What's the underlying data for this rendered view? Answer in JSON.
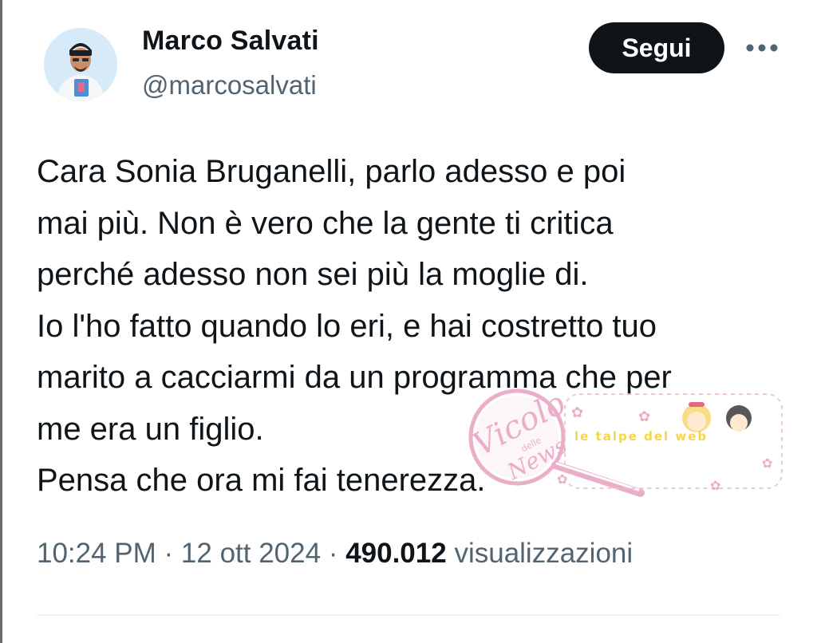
{
  "user": {
    "display_name": "Marco Salvati",
    "handle": "@marcosalvati",
    "follow_label": "Segui",
    "more_label": "•••",
    "avatar_icon": "profile-photo"
  },
  "tweet": {
    "lines": [
      "Cara Sonia Bruganelli, parlo adesso e poi",
      "mai più. Non è vero che la gente ti critica",
      "perché adesso non sei più la moglie di.",
      "Io l'ho fatto quando lo eri, e hai costretto tuo",
      "marito a cacciarmi da un programma che per",
      "me era un figlio.",
      "Pensa che ora mi fai tenerezza."
    ]
  },
  "meta": {
    "time": "10:24 PM",
    "separator": " · ",
    "date": "12 ott 2024",
    "views_count": "490.012",
    "views_label": "visualizzazioni"
  },
  "watermarks": {
    "vicolo_script": "Vicolo",
    "vicolo_small": "delle",
    "vicolo_bottom": "News",
    "talpe_text": "le talpe del web"
  },
  "colors": {
    "primary_text": "#0f1419",
    "secondary_text": "#536471",
    "button_bg": "#0f1419",
    "button_text": "#ffffff",
    "divider": "#eff3f4",
    "watermark_pink": "#e8a0c0",
    "watermark_yellow": "#f3c400"
  }
}
